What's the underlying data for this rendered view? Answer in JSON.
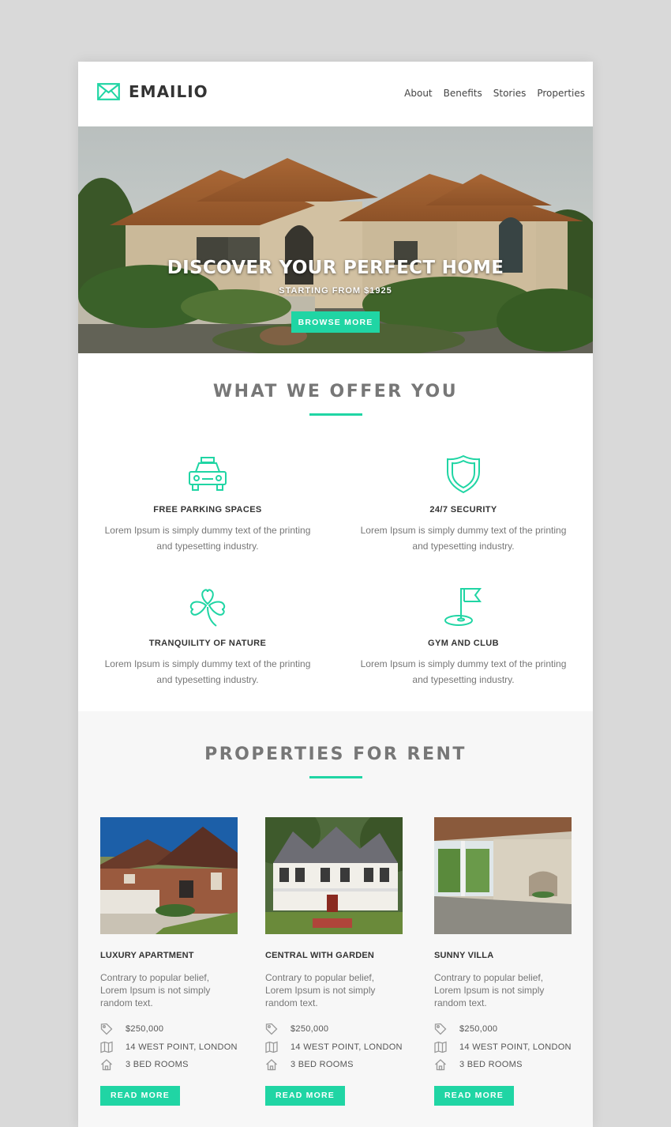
{
  "brand": {
    "name": "EMAILIO",
    "accent": "#20d5a4"
  },
  "nav": {
    "items": [
      "About",
      "Benefits",
      "Stories",
      "Properties"
    ]
  },
  "hero": {
    "title": "DISCOVER YOUR PERFECT HOME",
    "subtitle": "STARTING FROM $1925",
    "button": "BROWSE MORE"
  },
  "offer": {
    "title": "WHAT WE OFFER YOU",
    "features": [
      {
        "icon": "car-icon",
        "title": "FREE PARKING SPACES",
        "text1": "Lorem Ipsum is simply dummy text of the printing",
        "text2": "and typesetting industry."
      },
      {
        "icon": "shield-icon",
        "title": "24/7 SECURITY",
        "text1": "Lorem Ipsum is simply dummy text of the printing",
        "text2": "and typesetting industry."
      },
      {
        "icon": "clover-icon",
        "title": "TRANQUILITY OF NATURE",
        "text1": "Lorem Ipsum is simply dummy text of the printing",
        "text2": "and typesetting industry."
      },
      {
        "icon": "flag-icon",
        "title": "GYM AND CLUB",
        "text1": "Lorem Ipsum is simply dummy text of the printing",
        "text2": "and typesetting industry."
      }
    ]
  },
  "properties": {
    "title": "PROPERTIES FOR RENT",
    "items": [
      {
        "name": "LUXURY APARTMENT",
        "desc": "Contrary to popular belief, Lorem Ipsum is not simply random text.",
        "price": "$250,000",
        "address": "14 WEST POINT, LONDON",
        "rooms": "3 BED ROOMS",
        "button": "READ MORE"
      },
      {
        "name": "CENTRAL WITH GARDEN",
        "desc": "Contrary to popular belief, Lorem Ipsum is not simply random text.",
        "price": "$250,000",
        "address": "14 WEST POINT, LONDON",
        "rooms": "3 BED ROOMS",
        "button": "READ MORE"
      },
      {
        "name": "SUNNY VILLA",
        "desc": "Contrary to popular belief, Lorem Ipsum is not simply random text.",
        "price": "$250,000",
        "address": "14 WEST POINT, LONDON",
        "rooms": "3 BED ROOMS",
        "button": "READ MORE"
      }
    ]
  }
}
